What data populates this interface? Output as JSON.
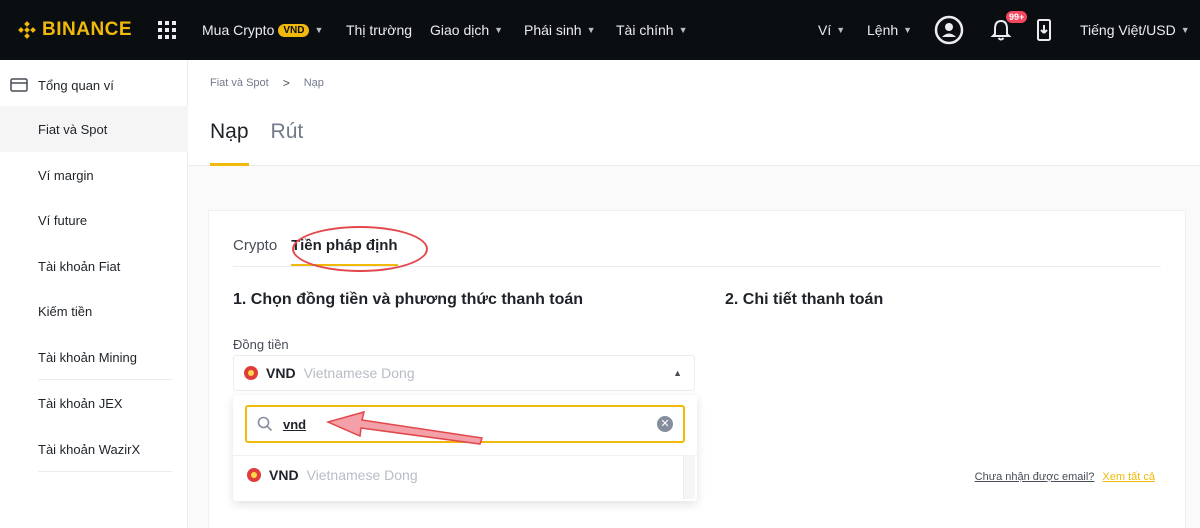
{
  "topbar": {
    "logo": "BINANCE",
    "nav": [
      {
        "label": "Mua Crypto",
        "badge": "VND"
      },
      {
        "label": "Thị trường"
      },
      {
        "label": "Giao dịch"
      },
      {
        "label": "Phái sinh"
      },
      {
        "label": "Tài chính"
      }
    ],
    "right": {
      "wallet": "Ví",
      "orders": "Lệnh",
      "notif_count": "99+",
      "language": "Tiếng Việt/USD"
    }
  },
  "sidebar": {
    "items": [
      {
        "label": "Tổng quan ví"
      },
      {
        "label": "Fiat và Spot"
      },
      {
        "label": "Ví margin"
      },
      {
        "label": "Ví future"
      },
      {
        "label": "Tài khoản Fiat"
      },
      {
        "label": "Kiếm tiền"
      },
      {
        "label": "Tài khoản Mining"
      },
      {
        "label": "Tài khoản JEX"
      },
      {
        "label": "Tài khoản WazirX"
      }
    ],
    "active_index": 1
  },
  "breadcrumb": {
    "parent": "Fiat và Spot",
    "separator": ">",
    "current": "Nạp"
  },
  "page_tabs": [
    "Nạp",
    "Rút"
  ],
  "deposit": {
    "subtabs": [
      "Crypto",
      "Tiền pháp định"
    ],
    "active_subtab": 1,
    "step1_title": "1. Chọn đồng tiền và phương thức thanh toán",
    "step2_title": "2. Chi tiết thanh toán",
    "currency_label": "Đồng tiền",
    "selected": {
      "code": "VND",
      "name": "Vietnamese Dong"
    },
    "search_value": "vnd",
    "option": {
      "code": "VND",
      "name": "Vietnamese Dong"
    },
    "email_question": "Chưa nhận được email?",
    "view_all": "Xem tất cả"
  },
  "colors": {
    "brand": "#f0b90b",
    "topbar_bg": "#0b0e11",
    "highlight": "#e2474b",
    "vnd_icon": "#e03c3c"
  }
}
